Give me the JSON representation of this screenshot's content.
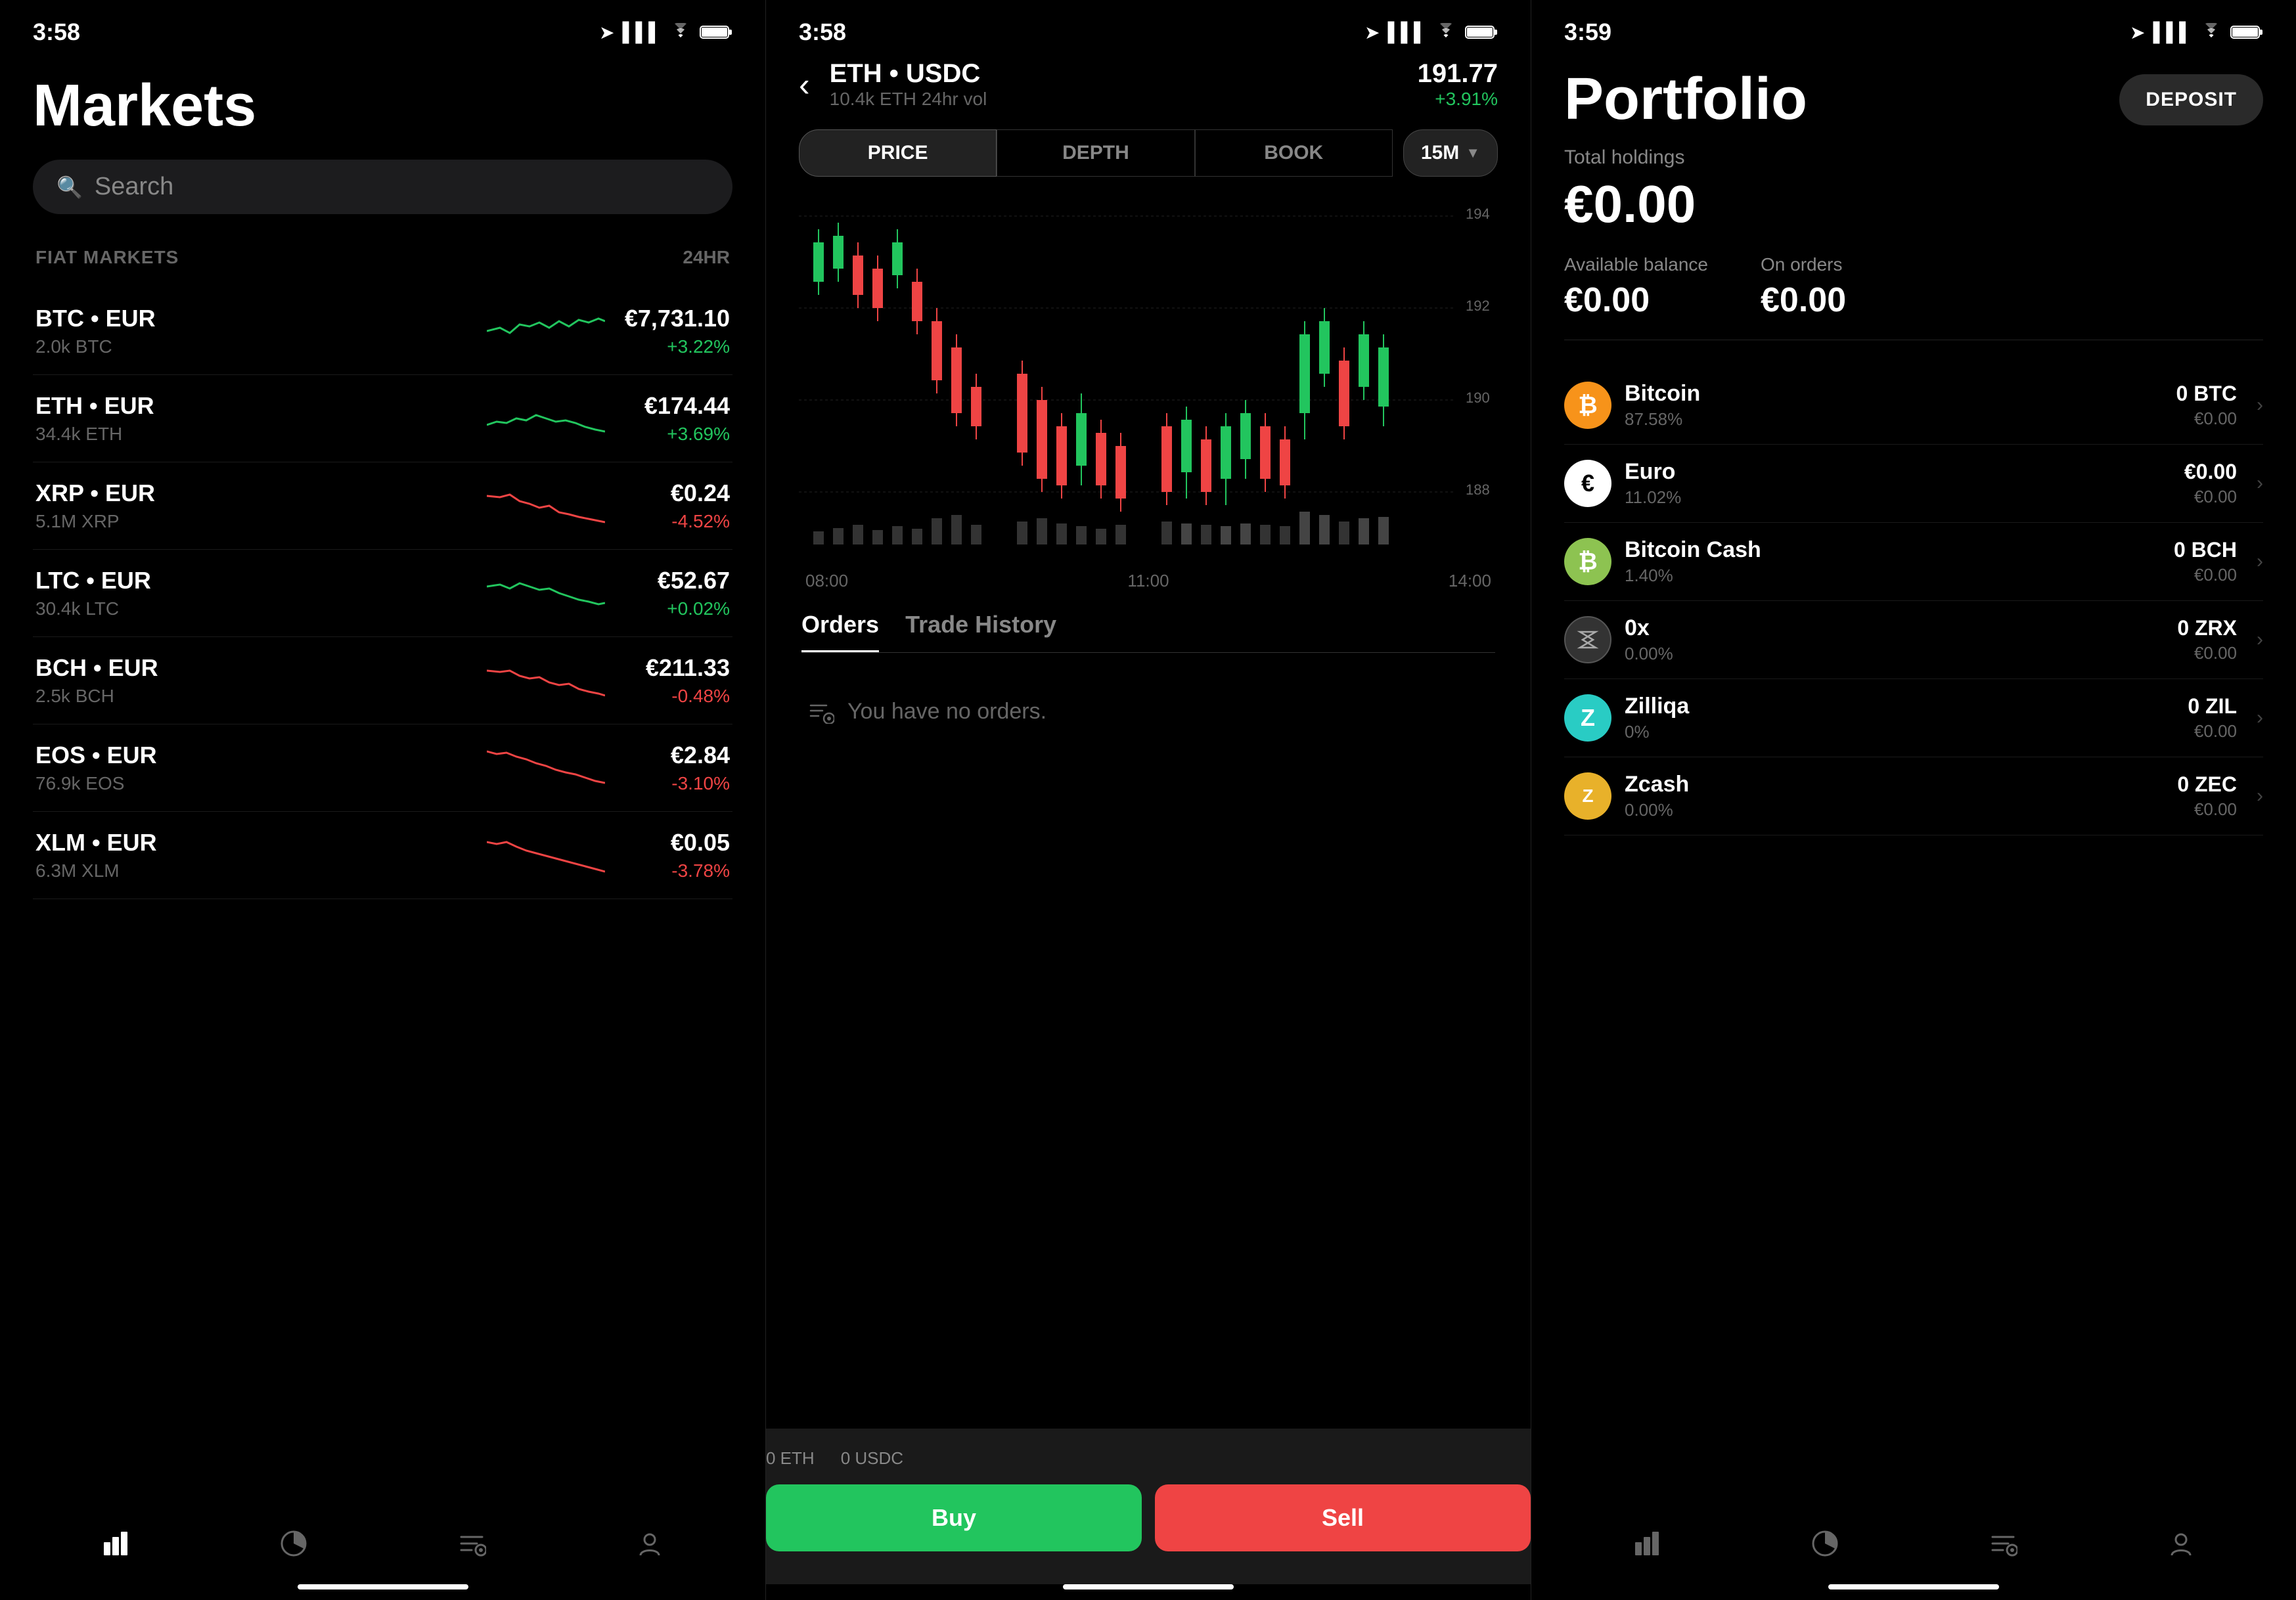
{
  "panel1": {
    "statusTime": "3:58",
    "title": "Markets",
    "search": {
      "placeholder": "Search"
    },
    "sectionLabel": "FIAT MARKETS",
    "sectionHeader24hr": "24HR",
    "markets": [
      {
        "pair": "BTC • EUR",
        "vol": "2.0k BTC",
        "price": "€7,731.10",
        "change": "+3.22%",
        "positive": true
      },
      {
        "pair": "ETH • EUR",
        "vol": "34.4k ETH",
        "price": "€174.44",
        "change": "+3.69%",
        "positive": true
      },
      {
        "pair": "XRP • EUR",
        "vol": "5.1M XRP",
        "price": "€0.24",
        "change": "-4.52%",
        "positive": false
      },
      {
        "pair": "LTC • EUR",
        "vol": "30.4k LTC",
        "price": "€52.67",
        "change": "+0.02%",
        "positive": true
      },
      {
        "pair": "BCH • EUR",
        "vol": "2.5k BCH",
        "price": "€211.33",
        "change": "-0.48%",
        "positive": false
      },
      {
        "pair": "EOS • EUR",
        "vol": "76.9k EOS",
        "price": "€2.84",
        "change": "-3.10%",
        "positive": false
      },
      {
        "pair": "XLM • EUR",
        "vol": "6.3M XLM",
        "price": "€0.05",
        "change": "-3.78%",
        "positive": false
      }
    ]
  },
  "panel2": {
    "statusTime": "3:58",
    "backLabel": "‹",
    "pairTitle": "ETH • USDC",
    "pairVol": "10.4k ETH 24hr vol",
    "price": "191.77",
    "priceChange": "+3.91%",
    "tabs": [
      "PRICE",
      "DEPTH",
      "BOOK"
    ],
    "activeTab": "PRICE",
    "timeframe": "15M",
    "priceLabels": [
      "194",
      "192",
      "190",
      "188"
    ],
    "timeLabels": [
      "08:00",
      "11:00",
      "14:00"
    ],
    "ordersTab": "Orders",
    "tradeHistoryTab": "Trade History",
    "noOrdersText": "You have no orders.",
    "ethBalance": "0 ETH",
    "usdcBalance": "0 USDC",
    "buyLabel": "Buy",
    "sellLabel": "Sell"
  },
  "panel3": {
    "statusTime": "3:59",
    "title": "Portfolio",
    "depositLabel": "DEPOSIT",
    "totalHoldingsLabel": "Total holdings",
    "totalHoldingsValue": "€0.00",
    "availableBalanceLabel": "Available balance",
    "availableBalanceValue": "€0.00",
    "onOrdersLabel": "On orders",
    "onOrdersValue": "€0.00",
    "assets": [
      {
        "name": "Bitcoin",
        "pct": "87.58%",
        "crypto": "0 BTC",
        "fiat": "€0.00",
        "iconType": "btc",
        "iconChar": "₿"
      },
      {
        "name": "Euro",
        "pct": "11.02%",
        "crypto": "€0.00",
        "fiat": "€0.00",
        "iconType": "eur",
        "iconChar": "€"
      },
      {
        "name": "Bitcoin Cash",
        "pct": "1.40%",
        "crypto": "0 BCH",
        "fiat": "€0.00",
        "iconType": "bch",
        "iconChar": "₿"
      },
      {
        "name": "0x",
        "pct": "0.00%",
        "crypto": "0 ZRX",
        "fiat": "€0.00",
        "iconType": "zrx",
        "iconChar": "✕"
      },
      {
        "name": "Zilliqa",
        "pct": "0%",
        "crypto": "0 ZIL",
        "fiat": "€0.00",
        "iconType": "zil",
        "iconChar": "Z"
      },
      {
        "name": "Zcash",
        "pct": "0.00%",
        "crypto": "0 ZEC",
        "fiat": "€0.00",
        "iconType": "zec",
        "iconChar": "ⓩ"
      }
    ]
  },
  "colors": {
    "positive": "#22c55e",
    "negative": "#ef4444",
    "accent": "#fff",
    "muted": "#666"
  }
}
